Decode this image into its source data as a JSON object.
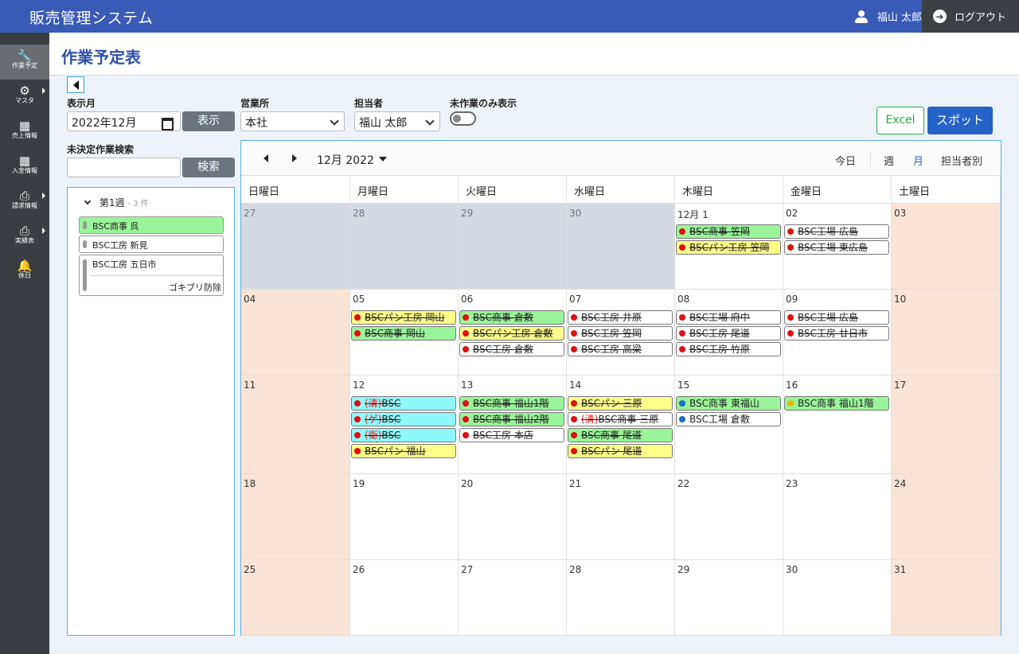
{
  "header": {
    "app_title": "販売管理システム",
    "user_name": "福山 太郎",
    "logout_label": "ログアウト"
  },
  "sidebar": {
    "items": [
      {
        "label": "作業予定",
        "icon": "wrench-icon",
        "active": true,
        "submenu": false
      },
      {
        "label": "マスタ",
        "icon": "gear-icon",
        "active": false,
        "submenu": true
      },
      {
        "label": "売上情報",
        "icon": "table-icon",
        "active": false,
        "submenu": false
      },
      {
        "label": "入金情報",
        "icon": "table-icon",
        "active": false,
        "submenu": false
      },
      {
        "label": "請求情報",
        "icon": "printer-icon",
        "active": false,
        "submenu": true
      },
      {
        "label": "実績表",
        "icon": "printer-icon",
        "active": false,
        "submenu": true
      },
      {
        "label": "休日",
        "icon": "bell-icon",
        "active": false,
        "submenu": false
      }
    ]
  },
  "page": {
    "title": "作業予定表"
  },
  "filters": {
    "month_label": "表示月",
    "month_value": "2022年12月",
    "show_button": "表示",
    "office_label": "営業所",
    "office_value": "本社",
    "staff_label": "担当者",
    "staff_value": "福山 太郎",
    "unworked_label": "未作業のみ表示",
    "unworked_on": false,
    "search_label": "未決定作業検索",
    "search_value": "",
    "search_button": "検索",
    "excel_button": "Excel",
    "spot_button": "スポット"
  },
  "pending": {
    "week_label": "第1週",
    "week_count": "- 3 件",
    "items": [
      {
        "name": "BSC商事 呉",
        "sub": "",
        "color": "#9af59a"
      },
      {
        "name": "BSC工房 新見",
        "sub": "",
        "color": "#ffffff"
      },
      {
        "name": "BSC工房 五日市",
        "sub": "ゴキブリ防除",
        "color": "#ffffff"
      }
    ]
  },
  "calendar": {
    "month_label": "12月 2022",
    "today_label": "今日",
    "view_week": "週",
    "view_month": "月",
    "view_staff": "担当者別",
    "active_view": "月",
    "weekdays": [
      "日曜日",
      "月曜日",
      "火曜日",
      "水曜日",
      "木曜日",
      "金曜日",
      "土曜日"
    ],
    "weeks": [
      [
        {
          "num": "27",
          "other": true,
          "events": []
        },
        {
          "num": "28",
          "other": true,
          "events": []
        },
        {
          "num": "29",
          "other": true,
          "events": []
        },
        {
          "num": "30",
          "other": true,
          "events": []
        },
        {
          "num": "12月 1",
          "other": false,
          "events": [
            {
              "pre": "",
              "text": "BSC商事 笠岡",
              "bg": "#9af59a",
              "dot": "#e01010",
              "done": true
            },
            {
              "pre": "",
              "text": "BSCパン工房 笠岡",
              "bg": "#fdfd8a",
              "dot": "#e01010",
              "done": true
            }
          ]
        },
        {
          "num": "02",
          "other": false,
          "events": [
            {
              "pre": "",
              "text": "BSC工場 広島",
              "bg": "#ffffff",
              "dot": "#e01010",
              "done": true
            },
            {
              "pre": "",
              "text": "BSC工場 東広島",
              "bg": "#ffffff",
              "dot": "#e01010",
              "done": true
            }
          ]
        },
        {
          "num": "03",
          "other": false,
          "events": []
        }
      ],
      [
        {
          "num": "04",
          "other": false,
          "events": []
        },
        {
          "num": "05",
          "other": false,
          "events": [
            {
              "pre": "",
              "text": "BSCパン工房 岡山",
              "bg": "#fdfd8a",
              "dot": "#e01010",
              "done": true
            },
            {
              "pre": "",
              "text": "BSC商事 岡山",
              "bg": "#9af59a",
              "dot": "#e01010",
              "done": true
            }
          ]
        },
        {
          "num": "06",
          "other": false,
          "events": [
            {
              "pre": "",
              "text": "BSC商事 倉敷",
              "bg": "#9af59a",
              "dot": "#e01010",
              "done": true
            },
            {
              "pre": "",
              "text": "BSCパン工房 倉敷",
              "bg": "#fdfd8a",
              "dot": "#e01010",
              "done": true
            },
            {
              "pre": "",
              "text": "BSC工房 倉敷",
              "bg": "#ffffff",
              "dot": "#e01010",
              "done": true
            }
          ]
        },
        {
          "num": "07",
          "other": false,
          "events": [
            {
              "pre": "",
              "text": "BSC工房 井原",
              "bg": "#ffffff",
              "dot": "#e01010",
              "done": true
            },
            {
              "pre": "",
              "text": "BSC工房 笠岡",
              "bg": "#ffffff",
              "dot": "#e01010",
              "done": true
            },
            {
              "pre": "",
              "text": "BSC工房 高梁",
              "bg": "#ffffff",
              "dot": "#e01010",
              "done": true
            }
          ]
        },
        {
          "num": "08",
          "other": false,
          "events": [
            {
              "pre": "",
              "text": "BSC工場 府中",
              "bg": "#ffffff",
              "dot": "#e01010",
              "done": true
            },
            {
              "pre": "",
              "text": "BSC工房 尾道",
              "bg": "#ffffff",
              "dot": "#e01010",
              "done": true
            },
            {
              "pre": "",
              "text": "BSC工房 竹原",
              "bg": "#ffffff",
              "dot": "#e01010",
              "done": true
            }
          ]
        },
        {
          "num": "09",
          "other": false,
          "events": [
            {
              "pre": "",
              "text": "BSC工場 広島",
              "bg": "#ffffff",
              "dot": "#e01010",
              "done": true
            },
            {
              "pre": "",
              "text": "BSC工房 廿日市",
              "bg": "#ffffff",
              "dot": "#e01010",
              "done": true
            }
          ]
        },
        {
          "num": "10",
          "other": false,
          "events": []
        }
      ],
      [
        {
          "num": "11",
          "other": false,
          "events": []
        },
        {
          "num": "12",
          "other": false,
          "events": [
            {
              "pre": "(清)",
              "text": "BSC",
              "bg": "#8ff8fb",
              "dot": "#e01010",
              "done": true
            },
            {
              "pre": "(ゲ)",
              "text": "BSC",
              "bg": "#8ff8fb",
              "dot": "#e01010",
              "done": true
            },
            {
              "pre": "(衛)",
              "text": "BSC",
              "bg": "#8ff8fb",
              "dot": "#e01010",
              "done": true
            },
            {
              "pre": "",
              "text": "BSCパン 福山",
              "bg": "#fdfd8a",
              "dot": "#e01010",
              "done": true
            }
          ]
        },
        {
          "num": "13",
          "other": false,
          "events": [
            {
              "pre": "",
              "text": "BSC商事 福山1階",
              "bg": "#9af59a",
              "dot": "#e01010",
              "done": true
            },
            {
              "pre": "",
              "text": "BSC商事 福山2階",
              "bg": "#9af59a",
              "dot": "#e01010",
              "done": true
            },
            {
              "pre": "",
              "text": "BSC工房 本店",
              "bg": "#ffffff",
              "dot": "#e01010",
              "done": true
            }
          ]
        },
        {
          "num": "14",
          "other": false,
          "events": [
            {
              "pre": "",
              "text": "BSCパン 三原",
              "bg": "#fdfd8a",
              "dot": "#e01010",
              "done": true
            },
            {
              "pre": "(清)",
              "text": "BSC商事 三原",
              "bg": "#ffffff",
              "dot": "#e01010",
              "done": true
            },
            {
              "pre": "",
              "text": "BSC商事 尾道",
              "bg": "#9af59a",
              "dot": "#e01010",
              "done": true
            },
            {
              "pre": "",
              "text": "BSCパン 尾道",
              "bg": "#fdfd8a",
              "dot": "#e01010",
              "done": true
            }
          ]
        },
        {
          "num": "15",
          "other": false,
          "events": [
            {
              "pre": "",
              "text": "BSC商事 東福山",
              "bg": "#9af59a",
              "dot": "#1a6fc4",
              "done": false
            },
            {
              "pre": "",
              "text": "BSC工場 倉敷",
              "bg": "#ffffff",
              "dot": "#1a6fc4",
              "done": false
            }
          ]
        },
        {
          "num": "16",
          "other": false,
          "events": [
            {
              "pre": "",
              "text": "BSC商事 福山1階",
              "bg": "#9af59a",
              "dot": "#f0b400",
              "done": false
            }
          ]
        },
        {
          "num": "17",
          "other": false,
          "events": []
        }
      ],
      [
        {
          "num": "18",
          "other": false,
          "events": []
        },
        {
          "num": "19",
          "other": false,
          "events": []
        },
        {
          "num": "20",
          "other": false,
          "events": []
        },
        {
          "num": "21",
          "other": false,
          "events": []
        },
        {
          "num": "22",
          "other": false,
          "events": []
        },
        {
          "num": "23",
          "other": false,
          "events": []
        },
        {
          "num": "24",
          "other": false,
          "events": []
        }
      ],
      [
        {
          "num": "25",
          "other": false,
          "events": []
        },
        {
          "num": "26",
          "other": false,
          "events": []
        },
        {
          "num": "27",
          "other": false,
          "events": []
        },
        {
          "num": "28",
          "other": false,
          "events": []
        },
        {
          "num": "29",
          "other": false,
          "events": []
        },
        {
          "num": "30",
          "other": false,
          "events": []
        },
        {
          "num": "31",
          "other": false,
          "events": []
        }
      ]
    ]
  }
}
